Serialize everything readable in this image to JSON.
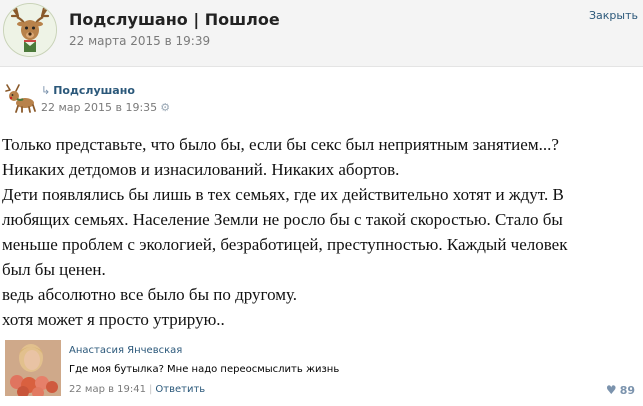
{
  "header": {
    "title": "Подслушано | Пошлое",
    "date": "22 марта 2015 в 19:39",
    "close_label": "Закрыть"
  },
  "repost": {
    "arrow_glyph": "↳",
    "source_name": "Подслушано",
    "date": "22 мар 2015 в 19:35",
    "gear_glyph": "⚙"
  },
  "post": {
    "lines": [
      "Только представьте, что было бы, если бы секс был неприятным занятием...?",
      "Никаких детдомов и изнасилований. Никаких абортов.",
      "Дети появлялись бы лишь в тех семьях, где их действительно хотят и ждут. В",
      "любящих семьях. Население Земли не росло бы с такой скоростью. Стало бы",
      "меньше проблем с экологией, безработицей, преступностью. Каждый человек",
      "был бы ценен.",
      "ведь абсолютно все было бы по другому.",
      "хотя может я просто утрирую.."
    ]
  },
  "comment": {
    "author": "Анастасия Янчевская",
    "text": "Где моя бутылка? Мне надо переосмыслить жизнь",
    "date": "22 мар в 19:41",
    "separator": "|",
    "reply_label": "Ответить"
  },
  "likes": {
    "heart_glyph": "♥",
    "count": "89"
  },
  "colors": {
    "link": "#2b587a",
    "muted": "#7a7a7a",
    "header_bg": "#f4f4f4"
  },
  "icons": {
    "group_avatar": "reindeer-logo",
    "repost_avatar": "reindeer-logo",
    "comment_avatar": "user-photo"
  }
}
